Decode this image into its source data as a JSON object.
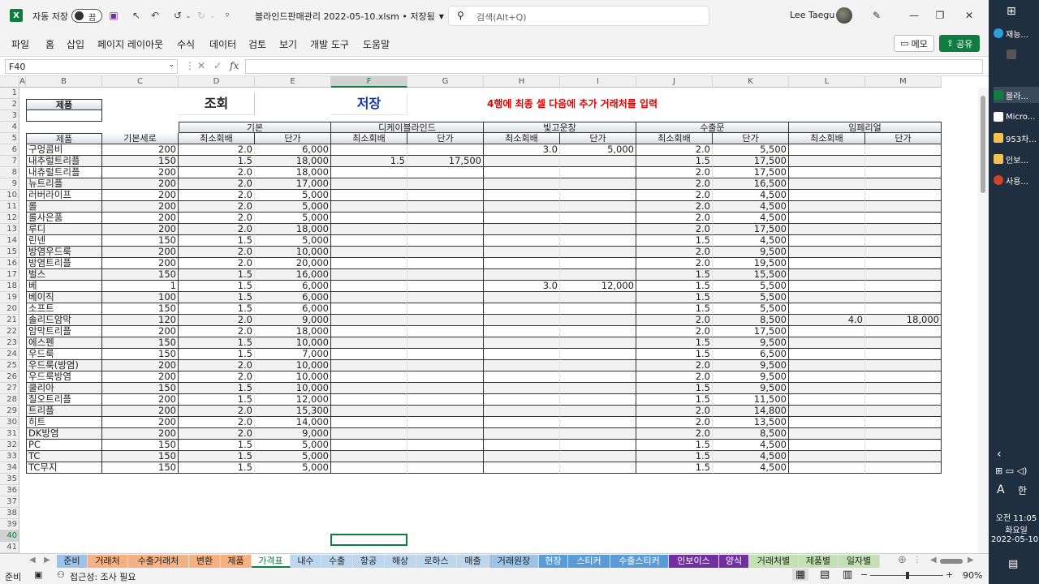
{
  "titlebar": {
    "app_icon": "X",
    "autosave_label": "자동 저장",
    "autosave_state": "끔",
    "doc_title": "블라인드판매관리 2022-05-10.xlsm • 저장됨",
    "search_placeholder": "검색(Alt+Q)",
    "user_name": "Lee Taegu"
  },
  "menu": [
    "파일",
    "홈",
    "삽입",
    "페이지 레이아웃",
    "수식",
    "데이터",
    "검토",
    "보기",
    "개발 도구",
    "도움말"
  ],
  "menu_right": {
    "memo": "메모",
    "share": "공유"
  },
  "formula_bar": {
    "name_box": "F40",
    "fx": "fx",
    "formula": ""
  },
  "columns": [
    "A",
    "B",
    "C",
    "D",
    "E",
    "F",
    "G",
    "H",
    "I",
    "J",
    "K",
    "L",
    "M"
  ],
  "selected_column": "F",
  "selected_row": "40",
  "sheet": {
    "product_label": "제품",
    "query_button": "조회",
    "save_button": "저장",
    "notice": "4행에 최종 셀 다음에 추가 거래처를 입력",
    "group_headers": [
      "기본",
      "디케이블라인드",
      "빛고운창",
      "수출문",
      "임페리얼"
    ],
    "sub_headers": [
      "제품",
      "기본세로",
      "최소회배",
      "단가",
      "최소회배",
      "단가",
      "최소회배",
      "단가",
      "최소회배",
      "단가",
      "최소회배",
      "단가"
    ],
    "data_rows": [
      [
        "구멍콤비",
        "200",
        "2.0",
        "6,000",
        "",
        "",
        "3.0",
        "5,000",
        "2.0",
        "5,500",
        "",
        ""
      ],
      [
        "내추럴트리플",
        "150",
        "1.5",
        "18,000",
        "1.5",
        "17,500",
        "",
        "",
        "1.5",
        "17,500",
        "",
        ""
      ],
      [
        "내츄럴트리플",
        "200",
        "2.0",
        "18,000",
        "",
        "",
        "",
        "",
        "2.0",
        "17,500",
        "",
        ""
      ],
      [
        "뉴트리플",
        "200",
        "2.0",
        "17,000",
        "",
        "",
        "",
        "",
        "2.0",
        "16,500",
        "",
        ""
      ],
      [
        "러버라이프",
        "200",
        "2.0",
        "5,000",
        "",
        "",
        "",
        "",
        "2.0",
        "4,500",
        "",
        ""
      ],
      [
        "롤",
        "200",
        "2.0",
        "5,000",
        "",
        "",
        "",
        "",
        "2.0",
        "4,500",
        "",
        ""
      ],
      [
        "롤사은품",
        "200",
        "2.0",
        "5,000",
        "",
        "",
        "",
        "",
        "2.0",
        "4,500",
        "",
        ""
      ],
      [
        "루디",
        "200",
        "2.0",
        "18,000",
        "",
        "",
        "",
        "",
        "2.0",
        "17,500",
        "",
        ""
      ],
      [
        "린넨",
        "150",
        "1.5",
        "5,000",
        "",
        "",
        "",
        "",
        "1.5",
        "4,500",
        "",
        ""
      ],
      [
        "방염우드룩",
        "200",
        "2.0",
        "10,000",
        "",
        "",
        "",
        "",
        "2.0",
        "9,500",
        "",
        ""
      ],
      [
        "방염트리플",
        "200",
        "2.0",
        "20,000",
        "",
        "",
        "",
        "",
        "2.0",
        "19,500",
        "",
        ""
      ],
      [
        "벌스",
        "150",
        "1.5",
        "16,000",
        "",
        "",
        "",
        "",
        "1.5",
        "15,500",
        "",
        ""
      ],
      [
        "베",
        "1",
        "1.5",
        "6,000",
        "",
        "",
        "3.0",
        "12,000",
        "1.5",
        "5,500",
        "",
        ""
      ],
      [
        "베이직",
        "100",
        "1.5",
        "6,000",
        "",
        "",
        "",
        "",
        "1.5",
        "5,500",
        "",
        ""
      ],
      [
        "소프트",
        "150",
        "1.5",
        "6,000",
        "",
        "",
        "",
        "",
        "1.5",
        "5,500",
        "",
        ""
      ],
      [
        "솔리드암막",
        "120",
        "2.0",
        "9,000",
        "",
        "",
        "",
        "",
        "2.0",
        "8,500",
        "4.0",
        "18,000"
      ],
      [
        "암막트리플",
        "200",
        "2.0",
        "18,000",
        "",
        "",
        "",
        "",
        "2.0",
        "17,500",
        "",
        ""
      ],
      [
        "에스펜",
        "150",
        "1.5",
        "10,000",
        "",
        "",
        "",
        "",
        "1.5",
        "9,500",
        "",
        ""
      ],
      [
        "우드룩",
        "150",
        "1.5",
        "7,000",
        "",
        "",
        "",
        "",
        "1.5",
        "6,500",
        "",
        ""
      ],
      [
        "우드룩(방염)",
        "200",
        "2.0",
        "10,000",
        "",
        "",
        "",
        "",
        "2.0",
        "9,500",
        "",
        ""
      ],
      [
        "우드룩방염",
        "200",
        "2.0",
        "10,000",
        "",
        "",
        "",
        "",
        "2.0",
        "9,500",
        "",
        ""
      ],
      [
        "쿨리아",
        "150",
        "1.5",
        "10,000",
        "",
        "",
        "",
        "",
        "1.5",
        "9,500",
        "",
        ""
      ],
      [
        "칠오트리플",
        "200",
        "1.5",
        "12,000",
        "",
        "",
        "",
        "",
        "1.5",
        "11,500",
        "",
        ""
      ],
      [
        "트리플",
        "200",
        "2.0",
        "15,300",
        "",
        "",
        "",
        "",
        "2.0",
        "14,800",
        "",
        ""
      ],
      [
        "히트",
        "200",
        "2.0",
        "14,000",
        "",
        "",
        "",
        "",
        "2.0",
        "13,500",
        "",
        ""
      ],
      [
        "DK방염",
        "200",
        "2.0",
        "9,000",
        "",
        "",
        "",
        "",
        "2.0",
        "8,500",
        "",
        ""
      ],
      [
        "PC",
        "150",
        "1.5",
        "5,000",
        "",
        "",
        "",
        "",
        "1.5",
        "4,500",
        "",
        ""
      ],
      [
        "TC",
        "150",
        "1.5",
        "5,000",
        "",
        "",
        "",
        "",
        "1.5",
        "4,500",
        "",
        ""
      ],
      [
        "TC무지",
        "150",
        "1.5",
        "5,000",
        "",
        "",
        "",
        "",
        "1.5",
        "4,500",
        "",
        ""
      ]
    ]
  },
  "tabs": [
    {
      "label": "준비",
      "color": "#9dc3e6"
    },
    {
      "label": "거래처",
      "color": "#f4b183"
    },
    {
      "label": "수출거래처",
      "color": "#f4b183"
    },
    {
      "label": "변환",
      "color": "#f4b183"
    },
    {
      "label": "제품",
      "color": "#f4b183"
    },
    {
      "label": "가격표",
      "color": "#ffffff"
    },
    {
      "label": "내수",
      "color": "#bdd7ee"
    },
    {
      "label": "수출",
      "color": "#bdd7ee"
    },
    {
      "label": "항공",
      "color": "#bdd7ee"
    },
    {
      "label": "해상",
      "color": "#bdd7ee"
    },
    {
      "label": "로하스",
      "color": "#bdd7ee"
    },
    {
      "label": "매출",
      "color": "#bdd7ee"
    },
    {
      "label": "거래원장",
      "color": "#9dc3e6"
    },
    {
      "label": "현장",
      "color": "#5b9bd5"
    },
    {
      "label": "스티커",
      "color": "#5b9bd5"
    },
    {
      "label": "수출스티커",
      "color": "#5b9bd5"
    },
    {
      "label": "인보이스",
      "color": "#7030a0"
    },
    {
      "label": "양식",
      "color": "#7030a0"
    },
    {
      "label": "거래처별",
      "color": "#c5e0b4"
    },
    {
      "label": "제품별",
      "color": "#c5e0b4"
    },
    {
      "label": "일자별",
      "color": "#c5e0b4"
    }
  ],
  "status": {
    "ready": "준비",
    "accessibility": "접근성: 조사 필요",
    "zoom": "90%"
  },
  "taskbar": {
    "items": [
      "재능...",
      "",
      "블라...",
      "Micro...",
      "953차...",
      "인보...",
      "사용..."
    ],
    "ime_a": "A",
    "ime_han": "한",
    "time": "오전 11:05",
    "day": "화요일",
    "date": "2022-05-10"
  },
  "colors": {
    "excel_green": "#107c41",
    "notice_red": "#e00000",
    "save_blue": "#1030c0"
  }
}
